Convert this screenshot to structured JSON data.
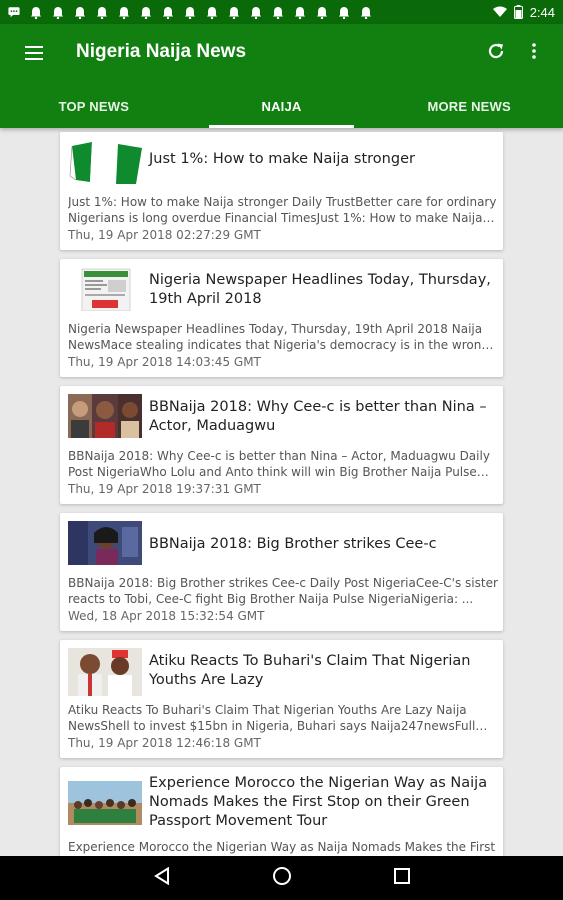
{
  "status_bar": {
    "time": "2:44",
    "icons": [
      "message-icon",
      "bell-icon",
      "bell-icon",
      "bell-icon",
      "bell-icon",
      "bell-icon",
      "bell-icon",
      "bell-icon",
      "bell-icon",
      "bell-icon",
      "bell-icon",
      "bell-icon",
      "bell-icon",
      "bell-icon",
      "bell-icon",
      "bell-icon",
      "bell-icon"
    ]
  },
  "app_bar": {
    "title": "Nigeria Naija News",
    "background_color": "#118011",
    "status_color": "#0a6a0a"
  },
  "tabs": [
    {
      "label": "TOP NEWS",
      "active": false
    },
    {
      "label": "NAIJA",
      "active": true
    },
    {
      "label": "MORE NEWS",
      "active": false
    }
  ],
  "articles": [
    {
      "title": "Just 1%: How to make Naija stronger",
      "summary": "Just 1%: How to make Naija stronger  Daily TrustBetter care for ordinary Nigerians is long overdue  Financial TimesJust 1%: How to make Naija s...",
      "date": "Thu, 19 Apr 2018 02:27:29 GMT",
      "thumb": "nigeria-flag"
    },
    {
      "title": "Nigeria Newspaper Headlines Today, Thursday, 19th April 2018",
      "summary": "Nigeria Newspaper Headlines Today, Thursday, 19th April 2018  Naija NewsMace stealing indicates that Nigeria's democracy is in the wrong h...",
      "date": "Thu, 19 Apr 2018 14:03:45 GMT",
      "thumb": "newspaper"
    },
    {
      "title": "BBNaija 2018: Why Cee-c is better than Nina – Actor, Maduagwu",
      "summary": "BBNaija 2018: Why Cee-c is better than Nina – Actor, Maduagwu  Daily Post NigeriaWho Lolu and Anto think will win Big Brother Naija  Pulse Ni...",
      "date": "Thu, 19 Apr 2018 19:37:31 GMT",
      "thumb": "faces"
    },
    {
      "title": "BBNaija 2018: Big Brother strikes Cee-c",
      "summary": "BBNaija 2018: Big Brother strikes Cee-c  Daily Post NigeriaCee-C's sister reacts to Tobi, Cee-C fight Big Brother Naija  Pulse NigeriaNigeria: ...",
      "date": "Wed, 18 Apr 2018 15:32:54 GMT",
      "thumb": "portrait"
    },
    {
      "title": "Atiku Reacts To Buhari's Claim That Nigerian Youths Are Lazy",
      "summary": "Atiku Reacts To Buhari's Claim That Nigerian Youths Are Lazy  Naija NewsShell to invest $15bn in Nigeria, Buhari says  Naija247newsFull co...",
      "date": "Thu, 19 Apr 2018 12:46:18 GMT",
      "thumb": "politicians"
    },
    {
      "title": "Experience Morocco the Nigerian Way as Naija Nomads Makes the First Stop on their Green Passport Movement Tour",
      "summary": "Experience Morocco the Nigerian Way as Naija Nomads Makes the First",
      "date": "",
      "thumb": "group"
    }
  ]
}
